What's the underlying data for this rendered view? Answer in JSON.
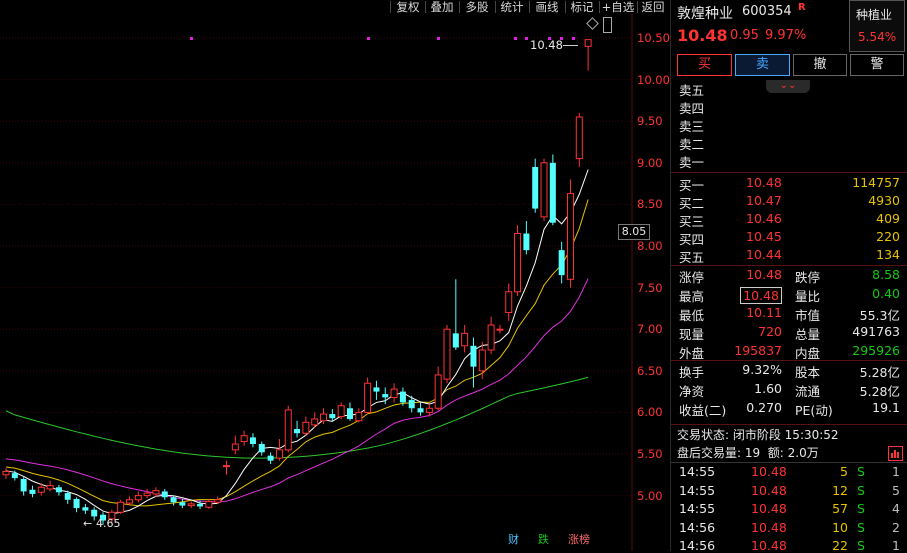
{
  "toolbar": {
    "items": [
      "复权",
      "叠加",
      "多股",
      "统计",
      "画线",
      "标记",
      "+自选",
      "返回"
    ]
  },
  "chart": {
    "price_axis": [
      "10.50",
      "10.00",
      "9.50",
      "9.00",
      "8.50",
      "8.00",
      "7.50",
      "7.00",
      "6.50",
      "6.00",
      "5.50",
      "5.00"
    ],
    "current_price_tag": "8.05",
    "high_label": "10.48",
    "low_label": "4.65",
    "bottom_markers": [
      "财",
      "跌",
      "涨榜"
    ],
    "colors": {
      "up": "#ff3333",
      "down": "#54ffff",
      "ma5": "#ffffff",
      "ma10": "#e6c200",
      "ma20": "#e030e0",
      "ma60": "#2cc82c"
    }
  },
  "stock": {
    "name": "敦煌种业",
    "code": "600354",
    "badge": "R",
    "price": "10.48",
    "change": "0.95",
    "change_pct": "9.97%",
    "sector_name": "种植业",
    "sector_pct": "5.54%"
  },
  "actions": {
    "buy": "买",
    "sell": "卖",
    "cancel": "撤",
    "alert": "警"
  },
  "asks": [
    {
      "label": "卖五",
      "price": "",
      "vol": ""
    },
    {
      "label": "卖四",
      "price": "",
      "vol": ""
    },
    {
      "label": "卖三",
      "price": "",
      "vol": ""
    },
    {
      "label": "卖二",
      "price": "",
      "vol": ""
    },
    {
      "label": "卖一",
      "price": "",
      "vol": ""
    }
  ],
  "bids": [
    {
      "label": "买一",
      "price": "10.48",
      "vol": "114757"
    },
    {
      "label": "买二",
      "price": "10.47",
      "vol": "4930"
    },
    {
      "label": "买三",
      "price": "10.46",
      "vol": "409"
    },
    {
      "label": "买四",
      "price": "10.45",
      "vol": "220"
    },
    {
      "label": "买五",
      "price": "10.44",
      "vol": "134"
    }
  ],
  "stats": [
    {
      "k1": "涨停",
      "v1": "10.48",
      "c1": "red",
      "k2": "跌停",
      "v2": "8.58",
      "c2": "green"
    },
    {
      "k1": "最高",
      "v1": "10.48",
      "c1": "red",
      "k2": "量比",
      "v2": "0.40",
      "c2": "green"
    },
    {
      "k1": "最低",
      "v1": "10.11",
      "c1": "red",
      "k2": "市值",
      "v2": "55.3亿",
      "c2": "white"
    },
    {
      "k1": "现量",
      "v1": "720",
      "c1": "red",
      "k2": "总量",
      "v2": "491763",
      "c2": "white"
    },
    {
      "k1": "外盘",
      "v1": "195837",
      "c1": "red",
      "k2": "内盘",
      "v2": "295926",
      "c2": "green"
    },
    {
      "k1": "换手",
      "v1": "9.32%",
      "c1": "white",
      "k2": "股本",
      "v2": "5.28亿",
      "c2": "white"
    },
    {
      "k1": "净资",
      "v1": "1.60",
      "c1": "white",
      "k2": "流通",
      "v2": "5.28亿",
      "c2": "white"
    },
    {
      "k1": "收益(二)",
      "v1": "0.270",
      "c1": "white",
      "k2": "PE(动)",
      "v2": "19.1",
      "c2": "white"
    }
  ],
  "status": {
    "line1": "交易状态: 闭市阶段 15:30:52",
    "line2": "盘后交易量: 19  额: 2.0万"
  },
  "ticks": [
    {
      "time": "14:55",
      "price": "10.48",
      "vol": "5",
      "side": "S",
      "n": "1"
    },
    {
      "time": "14:55",
      "price": "10.48",
      "vol": "12",
      "side": "S",
      "n": "5"
    },
    {
      "time": "14:55",
      "price": "10.48",
      "vol": "57",
      "side": "S",
      "n": "4"
    },
    {
      "time": "14:56",
      "price": "10.48",
      "vol": "10",
      "side": "S",
      "n": "2"
    },
    {
      "time": "14:56",
      "price": "10.48",
      "vol": "22",
      "side": "S",
      "n": "1"
    }
  ]
}
